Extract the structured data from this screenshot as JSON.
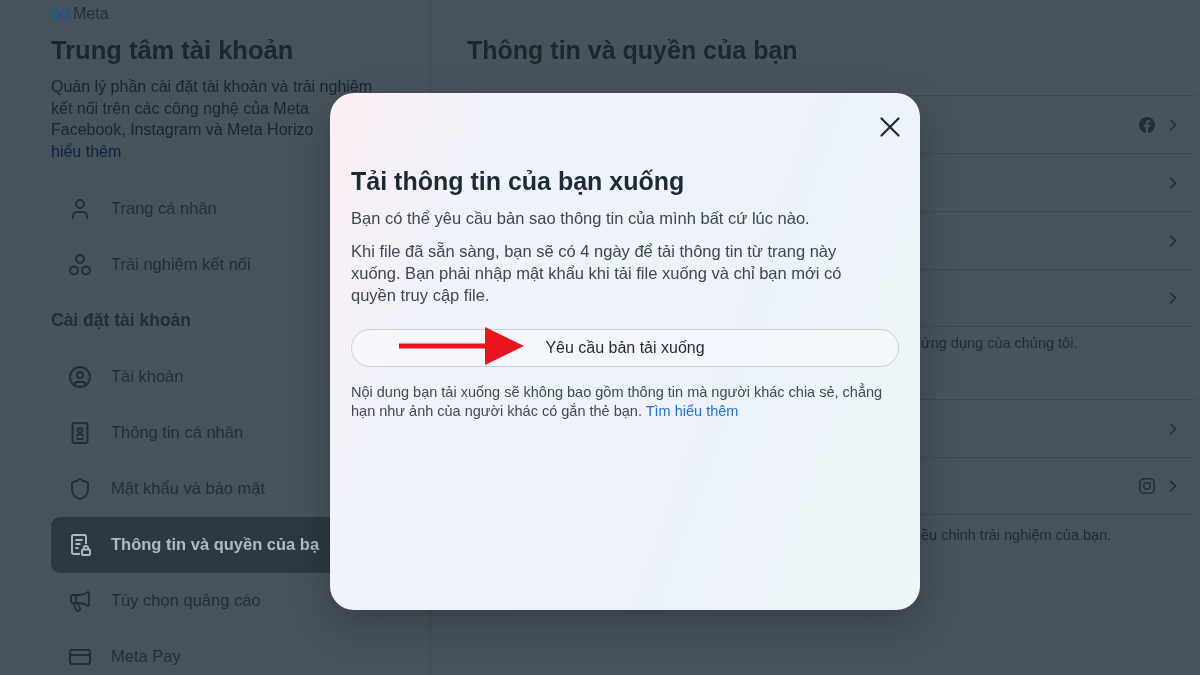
{
  "sidebar": {
    "brand": "Meta",
    "title": "Trung tâm tài khoản",
    "description_lines": [
      "Quản lý phần cài đặt tài khoản và trải nghiệm",
      "kết nối trên các công nghệ của Meta",
      "Facebook, Instagram và Meta Horizo"
    ],
    "learn_more_link": "hiểu thêm",
    "top_items": [
      {
        "label": "Trang cá nhân",
        "selected": false
      },
      {
        "label": "Trải nghiệm kết nối",
        "selected": false
      }
    ],
    "section_title": "Cài đặt tài khoản",
    "settings_items": [
      {
        "label": "Tài khoản",
        "selected": false
      },
      {
        "label": "Thông tin cá nhân",
        "selected": false
      },
      {
        "label": "Mật khẩu và bảo mật",
        "selected": false
      },
      {
        "label": "Thông tin và quyền của bạ",
        "selected": true
      },
      {
        "label": "Tùy chọn quảng cáo",
        "selected": false
      },
      {
        "label": "Meta Pay",
        "selected": false
      }
    ]
  },
  "main": {
    "title": "Thông tin và quyền của bạn",
    "cards": [
      {
        "rows": [
          {
            "kind": "facebook"
          },
          {
            "kind": "plain"
          },
          {
            "kind": "plain"
          },
          {
            "kind": "plain"
          }
        ],
        "note": "ứng dụng của chúng tôi."
      },
      {
        "rows": [
          {
            "kind": "plain"
          },
          {
            "kind": "instagram"
          }
        ],
        "note": "ều chỉnh trải nghiệm của bạn."
      }
    ]
  },
  "dialog": {
    "title": "Tải thông tin của bạn xuống",
    "paragraphs": [
      "Bạn có thể yêu cầu bản sao thông tin của mình bất cứ lúc nào.",
      "Khi file đã sẵn sàng, bạn sẽ có 4 ngày để tải thông tin từ trang này xuống. Bạn phải nhập mật khẩu khi tải file xuống và chỉ bạn mới có quyền truy cập file."
    ],
    "request_button": "Yêu cầu bản tải xuống",
    "footnote": "Nội dung bạn tải xuống sẽ không bao gồm thông tin mà người khác chia sẻ, chẳng hạn như ảnh của người khác có gắn thẻ bạn.",
    "footnote_link": "Tìm hiểu thêm"
  }
}
